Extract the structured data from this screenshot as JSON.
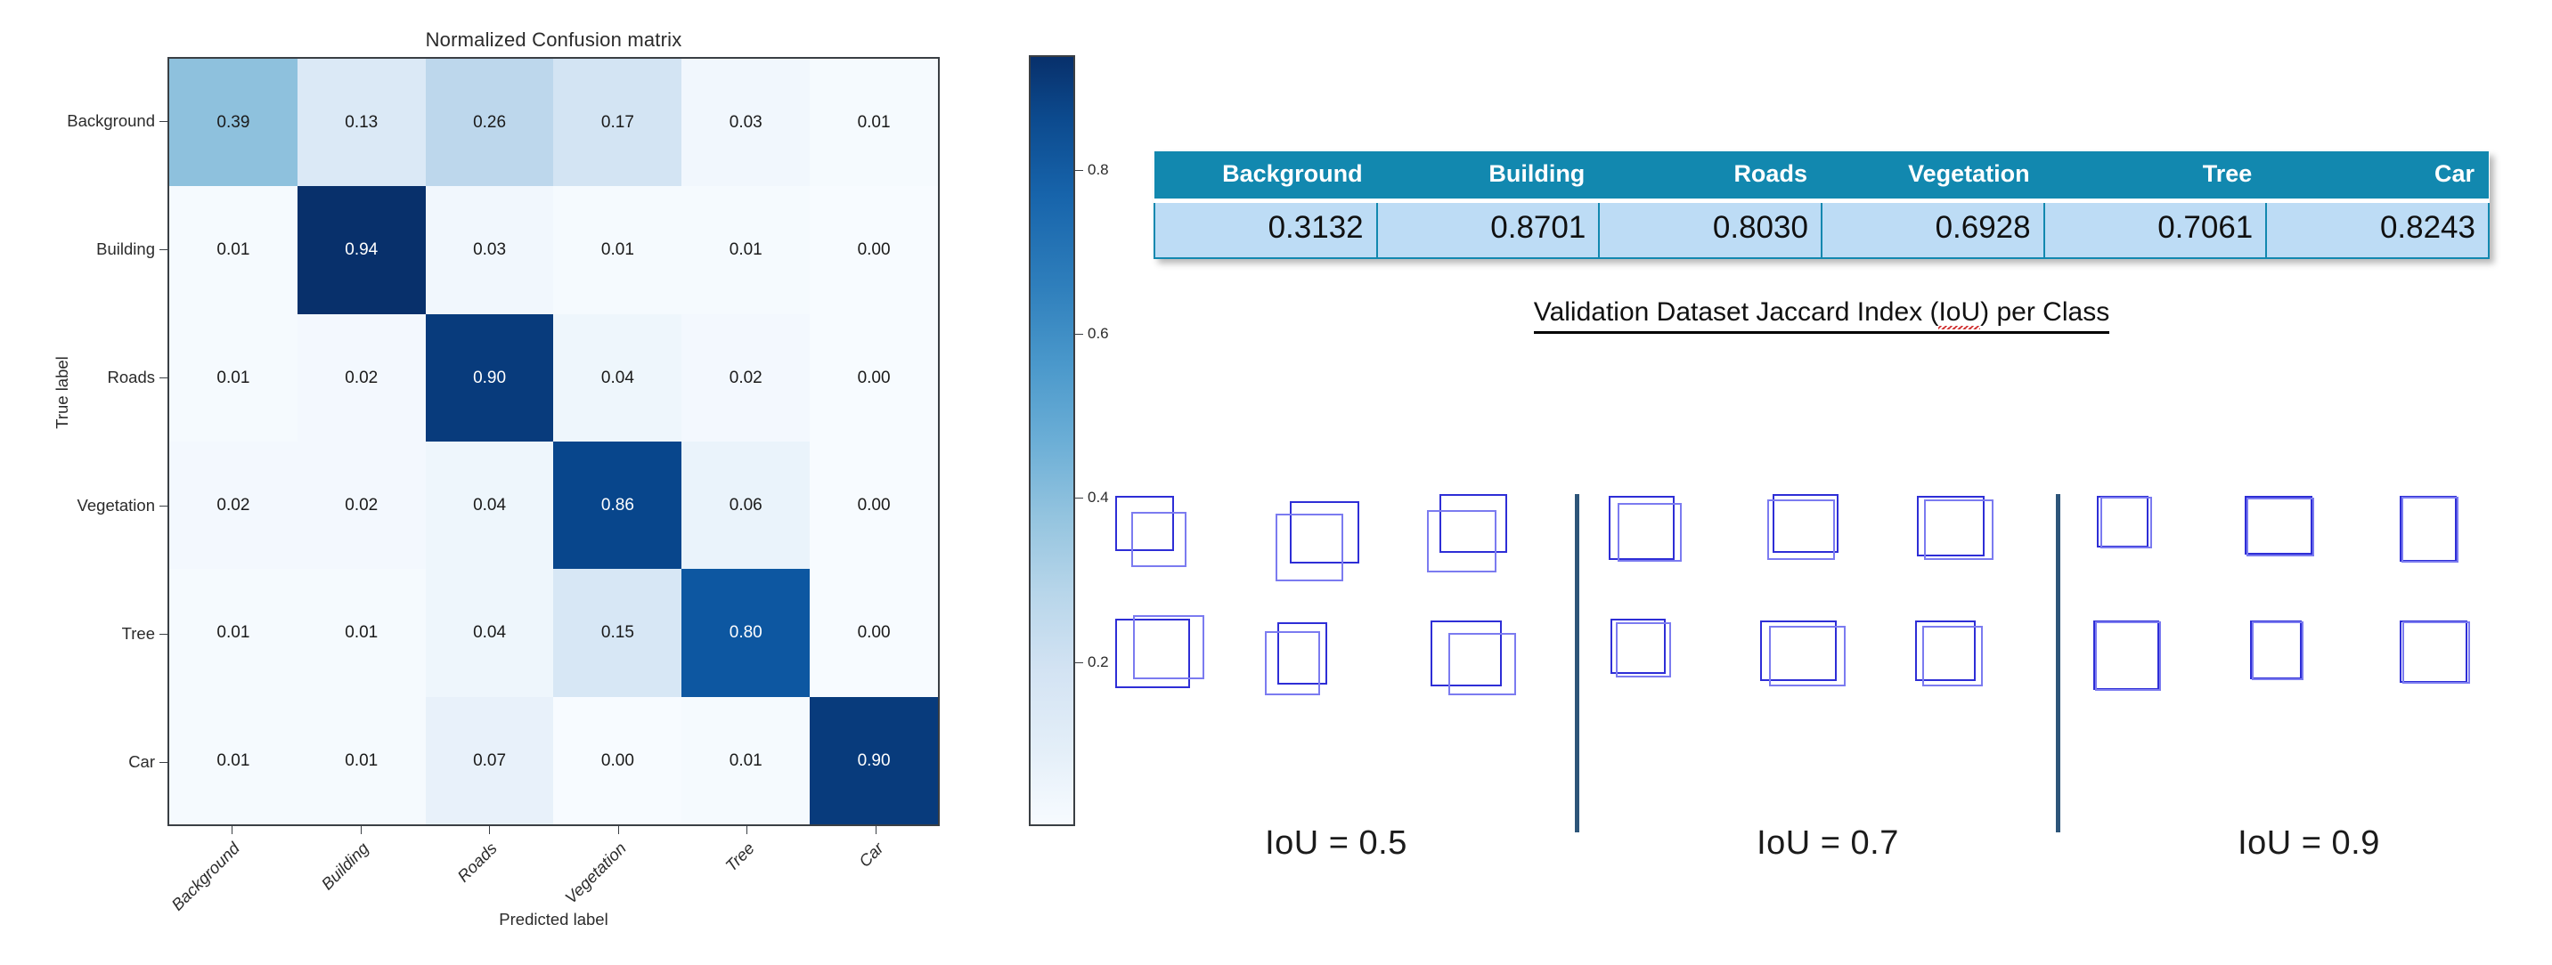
{
  "chart_data": [
    {
      "type": "heatmap",
      "title": "Normalized Confusion matrix",
      "xlabel": "Predicted label",
      "ylabel": "True label",
      "categories": [
        "Background",
        "Building",
        "Roads",
        "Vegetation",
        "Tree",
        "Car"
      ],
      "row_labels": [
        "Background",
        "Building",
        "Roads",
        "Vegetation",
        "Tree",
        "Car"
      ],
      "col_labels": [
        "Background",
        "Building",
        "Roads",
        "Vegetation",
        "Tree",
        "Car"
      ],
      "colormap": "Blues",
      "zlim": [
        0.0,
        0.94
      ],
      "colorbar": {
        "ticks": [
          0.2,
          0.4,
          0.6,
          0.8
        ],
        "tick_labels": [
          "0.2",
          "0.4",
          "0.6",
          "0.8"
        ],
        "position": "right"
      },
      "values": [
        [
          0.39,
          0.13,
          0.26,
          0.17,
          0.03,
          0.01
        ],
        [
          0.01,
          0.94,
          0.03,
          0.01,
          0.01,
          0.0
        ],
        [
          0.01,
          0.02,
          0.9,
          0.04,
          0.02,
          0.0
        ],
        [
          0.02,
          0.02,
          0.04,
          0.86,
          0.06,
          0.0
        ],
        [
          0.01,
          0.01,
          0.04,
          0.15,
          0.8,
          0.0
        ],
        [
          0.01,
          0.01,
          0.07,
          0.0,
          0.01,
          0.9
        ]
      ],
      "cell_text": [
        [
          "0.39",
          "0.13",
          "0.26",
          "0.17",
          "0.03",
          "0.01"
        ],
        [
          "0.01",
          "0.94",
          "0.03",
          "0.01",
          "0.01",
          "0.00"
        ],
        [
          "0.01",
          "0.02",
          "0.90",
          "0.04",
          "0.02",
          "0.00"
        ],
        [
          "0.02",
          "0.02",
          "0.04",
          "0.86",
          "0.06",
          "0.00"
        ],
        [
          "0.01",
          "0.01",
          "0.04",
          "0.15",
          "0.80",
          "0.00"
        ],
        [
          "0.01",
          "0.01",
          "0.07",
          "0.00",
          "0.01",
          "0.90"
        ]
      ]
    },
    {
      "type": "table",
      "title": "Validation Dataset Jaccard Index (IoU) per Class",
      "columns": [
        "Background",
        "Building",
        "Roads",
        "Vegetation",
        "Tree",
        "Car"
      ],
      "values": [
        0.3132,
        0.8701,
        0.803,
        0.6928,
        0.7061,
        0.8243
      ],
      "value_text": [
        "0.3132",
        "0.8701",
        "0.8030",
        "0.6928",
        "0.7061",
        "0.8243"
      ],
      "header_color": "#1288AF",
      "row_color": "#BDDCF5"
    }
  ],
  "confusion_matrix": {
    "title": "Normalized Confusion matrix",
    "xaxis_title": "Predicted label",
    "yaxis_title": "True label",
    "row_labels": [
      "Background",
      "Building",
      "Roads",
      "Vegetation",
      "Tree",
      "Car"
    ],
    "col_labels": [
      "Background",
      "Building",
      "Roads",
      "Vegetation",
      "Tree",
      "Car"
    ],
    "rows": [
      [
        "0.39",
        "0.13",
        "0.26",
        "0.17",
        "0.03",
        "0.01"
      ],
      [
        "0.01",
        "0.94",
        "0.03",
        "0.01",
        "0.01",
        "0.00"
      ],
      [
        "0.01",
        "0.02",
        "0.90",
        "0.04",
        "0.02",
        "0.00"
      ],
      [
        "0.02",
        "0.02",
        "0.04",
        "0.86",
        "0.06",
        "0.00"
      ],
      [
        "0.01",
        "0.01",
        "0.04",
        "0.15",
        "0.80",
        "0.00"
      ],
      [
        "0.01",
        "0.01",
        "0.07",
        "0.00",
        "0.01",
        "0.90"
      ]
    ],
    "colorbar_ticks": [
      "0.8",
      "0.6",
      "0.4",
      "0.2"
    ]
  },
  "iou_table": {
    "headers": [
      "Background",
      "Building",
      "Roads",
      "Vegetation",
      "Tree",
      "Car"
    ],
    "values": [
      "0.3132",
      "0.8701",
      "0.8030",
      "0.6928",
      "0.7061",
      "0.8243"
    ],
    "caption_prefix": "Validation Dataset Jaccard Index (",
    "caption_misspelled": "IoU",
    "caption_suffix": ") per Class",
    "caption_full": "Validation Dataset Jaccard Index (IoU) per Class"
  },
  "iou_diagram": {
    "groups": [
      {
        "label": "IoU = 0.5"
      },
      {
        "label": "IoU = 0.7"
      },
      {
        "label": "IoU = 0.9"
      }
    ]
  },
  "colors": {
    "table_header": "#1288AF",
    "table_row": "#BDDCF5",
    "box_primary": "#2e2ed6",
    "box_secondary": "#7b7bf0",
    "divider": "#2d5579",
    "heatmap_max": "#08306b",
    "heatmap_min": "#f7fbff"
  }
}
